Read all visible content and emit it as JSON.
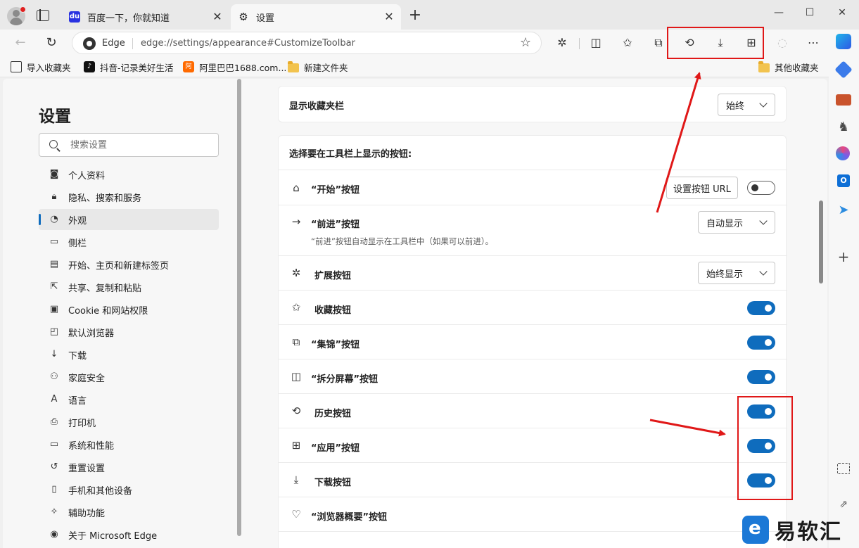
{
  "browser": {
    "tabs": [
      {
        "title": "百度一下，你就知道",
        "favicon": "baidu-paw-icon"
      },
      {
        "title": "设置",
        "favicon": "gear-icon"
      }
    ],
    "address": {
      "brand": "Edge",
      "url": "edge://settings/appearance#CustomizeToolbar"
    },
    "favorites": [
      {
        "label": "导入收藏夹"
      },
      {
        "label": "抖音-记录美好生活"
      },
      {
        "label": "阿里巴巴1688.com..."
      },
      {
        "label": "新建文件夹"
      }
    ],
    "other_favorites": "其他收藏夹"
  },
  "settings": {
    "title": "设置",
    "search_placeholder": "搜索设置",
    "nav": [
      {
        "label": "个人资料",
        "icon": "profile-icon"
      },
      {
        "label": "隐私、搜索和服务",
        "icon": "lock-icon"
      },
      {
        "label": "外观",
        "icon": "palette-icon",
        "active": true
      },
      {
        "label": "侧栏",
        "icon": "sidebar-icon"
      },
      {
        "label": "开始、主页和新建标签页",
        "icon": "home-grid-icon"
      },
      {
        "label": "共享、复制和粘贴",
        "icon": "share-icon"
      },
      {
        "label": "Cookie 和网站权限",
        "icon": "cookie-icon"
      },
      {
        "label": "默认浏览器",
        "icon": "browser-icon"
      },
      {
        "label": "下载",
        "icon": "download-icon"
      },
      {
        "label": "家庭安全",
        "icon": "family-icon"
      },
      {
        "label": "语言",
        "icon": "language-icon"
      },
      {
        "label": "打印机",
        "icon": "printer-icon"
      },
      {
        "label": "系统和性能",
        "icon": "laptop-icon"
      },
      {
        "label": "重置设置",
        "icon": "reset-icon"
      },
      {
        "label": "手机和其他设备",
        "icon": "phone-icon"
      },
      {
        "label": "辅助功能",
        "icon": "accessibility-icon"
      },
      {
        "label": "关于 Microsoft Edge",
        "icon": "edge-logo-icon"
      }
    ],
    "favorites_bar": {
      "label": "显示收藏夹栏",
      "value": "始终"
    },
    "toolbar_section": {
      "heading": "选择要在工具栏上显示的按钮:",
      "rows": [
        {
          "label": "“开始”按钮",
          "icon": "home-icon",
          "button": "设置按钮 URL",
          "toggle": false
        },
        {
          "label": "“前进”按钮",
          "icon": "arrow-right-icon",
          "dropdown": "自动显示",
          "sub": "“前进”按钮自动显示在工具栏中（如果可以前进）。"
        },
        {
          "label": "扩展按钮",
          "icon": "puzzle-icon",
          "dropdown": "始终显示"
        },
        {
          "label": "收藏按钮",
          "icon": "star-list-icon",
          "toggle": true
        },
        {
          "label": "“集锦”按钮",
          "icon": "collections-icon",
          "toggle": true
        },
        {
          "label": "“拆分屏幕”按钮",
          "icon": "split-screen-icon",
          "toggle": true
        },
        {
          "label": "历史按钮",
          "icon": "history-icon",
          "toggle": true
        },
        {
          "label": "“应用”按钮",
          "icon": "apps-icon",
          "toggle": true
        },
        {
          "label": "下载按钮",
          "icon": "download-icon",
          "toggle": true
        },
        {
          "label": "“浏览器概要”按钮",
          "icon": "heartbeat-icon"
        }
      ]
    }
  },
  "watermark": {
    "text": "易软汇"
  },
  "colors": {
    "accent": "#0f6cbd",
    "annotation": "#e01818"
  }
}
